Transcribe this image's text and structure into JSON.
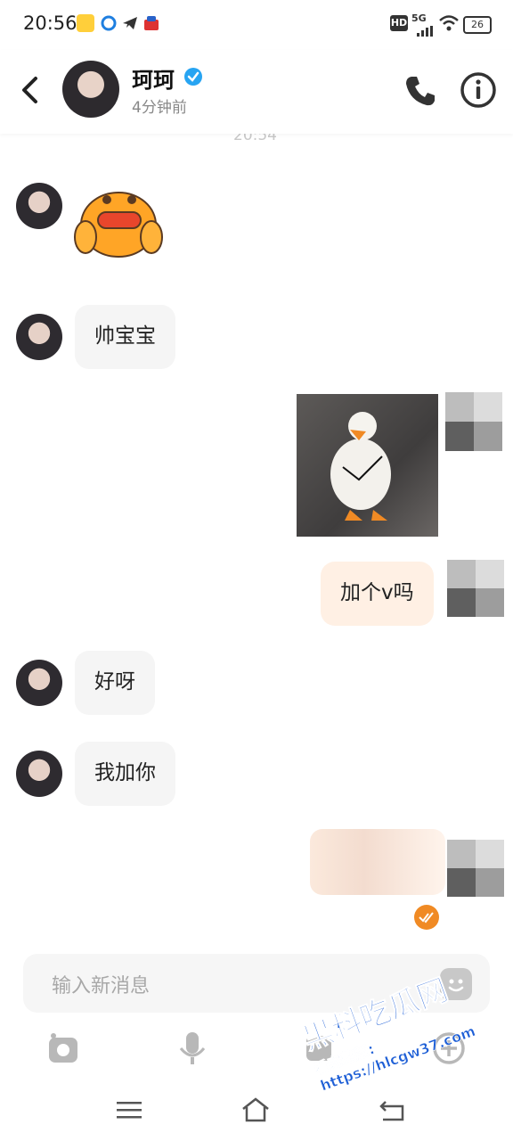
{
  "status_bar": {
    "time": "20:56",
    "network": "5G",
    "battery": "26",
    "hd": "HD"
  },
  "header": {
    "contact_name": "珂珂",
    "contact_status": "4分钟前"
  },
  "chat": {
    "timestamp_partial": "20:54",
    "messages": [
      {
        "sender": "contact",
        "type": "sticker",
        "sticker": "orange-blob-sticker"
      },
      {
        "sender": "contact",
        "type": "text",
        "text": "帅宝宝"
      },
      {
        "sender": "me",
        "type": "image",
        "image": "duck-photo"
      },
      {
        "sender": "me",
        "type": "text",
        "text": "加个v吗"
      },
      {
        "sender": "contact",
        "type": "text",
        "text": "好呀"
      },
      {
        "sender": "contact",
        "type": "text",
        "text": "我加你"
      },
      {
        "sender": "me",
        "type": "blurred",
        "text": ""
      }
    ]
  },
  "input": {
    "placeholder": "输入新消息"
  },
  "watermark": {
    "title": "黑料吃瓜网",
    "url": "看完整版: https://hlcgw37.com"
  },
  "colors": {
    "accent": "#f08a24",
    "verified": "#27a4f2",
    "bubble_in": "#f5f5f5",
    "bubble_out": "#fff0e4"
  }
}
